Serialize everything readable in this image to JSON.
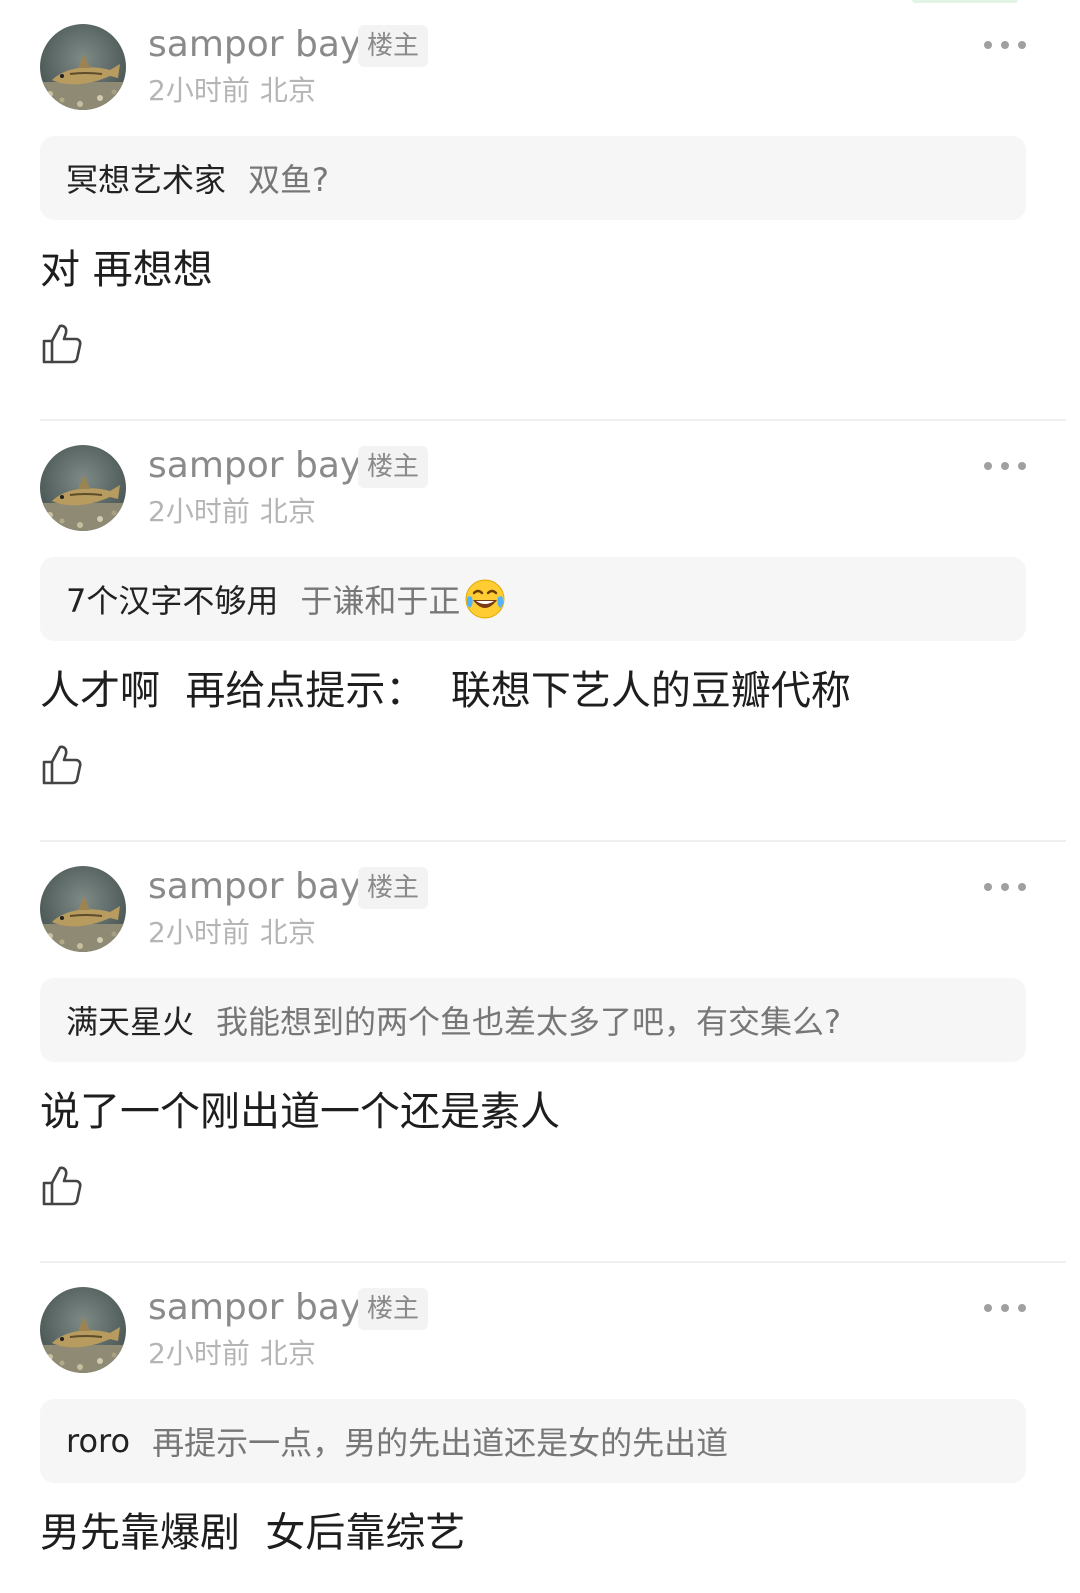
{
  "replies": [
    {
      "username": "sampor bay",
      "badge": "楼主",
      "time": "2小时前",
      "location": "北京",
      "quote_author": "冥想艺术家",
      "quote_text": "双鱼?",
      "content": "对 再想想",
      "avatar_icon": "catfish-avatar-icon",
      "more_icon": "more-horizontal-icon",
      "like_icon": "thumbs-up-icon"
    },
    {
      "username": "sampor bay",
      "badge": "楼主",
      "time": "2小时前",
      "location": "北京",
      "quote_author": "7个汉字不够用",
      "quote_text": "于谦和于正",
      "quote_emoji": "laughing-crying-emoji",
      "content": "人才啊  再给点提示：  联想下艺人的豆瓣代称",
      "avatar_icon": "catfish-avatar-icon",
      "more_icon": "more-horizontal-icon",
      "like_icon": "thumbs-up-icon"
    },
    {
      "username": "sampor bay",
      "badge": "楼主",
      "time": "2小时前",
      "location": "北京",
      "quote_author": "满天星火",
      "quote_text": "我能想到的两个鱼也差太多了吧，有交集么?",
      "content": "说了一个刚出道一个还是素人",
      "avatar_icon": "catfish-avatar-icon",
      "more_icon": "more-horizontal-icon",
      "like_icon": "thumbs-up-icon"
    },
    {
      "username": "sampor bay",
      "badge": "楼主",
      "time": "2小时前",
      "location": "北京",
      "quote_author": "roro",
      "quote_text": "再提示一点，男的先出道还是女的先出道",
      "content": "男先靠爆剧  女后靠综艺",
      "avatar_icon": "catfish-avatar-icon",
      "more_icon": "more-horizontal-icon",
      "like_icon": "thumbs-up-icon"
    }
  ],
  "colors": {
    "username": "#8a8a8a",
    "meta": "#b5b5b5",
    "quote_bg": "#f6f6f6",
    "quote_text": "#777777",
    "content": "#1e1e1e",
    "divider": "#efefef"
  }
}
